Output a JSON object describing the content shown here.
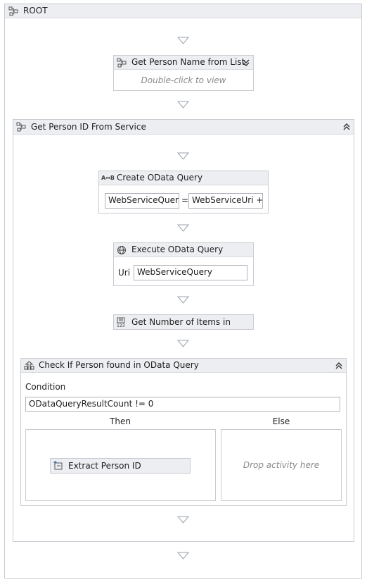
{
  "root": {
    "title": "ROOT"
  },
  "get_person_name": {
    "title": "Get Person Name from List",
    "hint": "Double-click to view"
  },
  "service": {
    "title": "Get Person ID From Service",
    "create_query": {
      "title": "Create OData Query",
      "lhs": "WebServiceQuery",
      "equals": "=",
      "rhs": "WebServiceUri + \"/I"
    },
    "execute_query": {
      "title": "Execute OData Query",
      "uri_label": "Uri",
      "uri_value": "WebServiceQuery"
    },
    "count_items": {
      "title": "Get Number of Items in Qu"
    },
    "check_person": {
      "title": "Check If Person found in OData Query",
      "condition_label": "Condition",
      "condition_value": "ODataQueryResultCount != 0",
      "then_label": "Then",
      "else_label": "Else",
      "then_activity": "Extract Person ID",
      "else_hint": "Drop activity here"
    }
  },
  "colors": {
    "header": "#eceef1",
    "border": "#c8ccd2",
    "arrow": "#9aa3ad"
  }
}
